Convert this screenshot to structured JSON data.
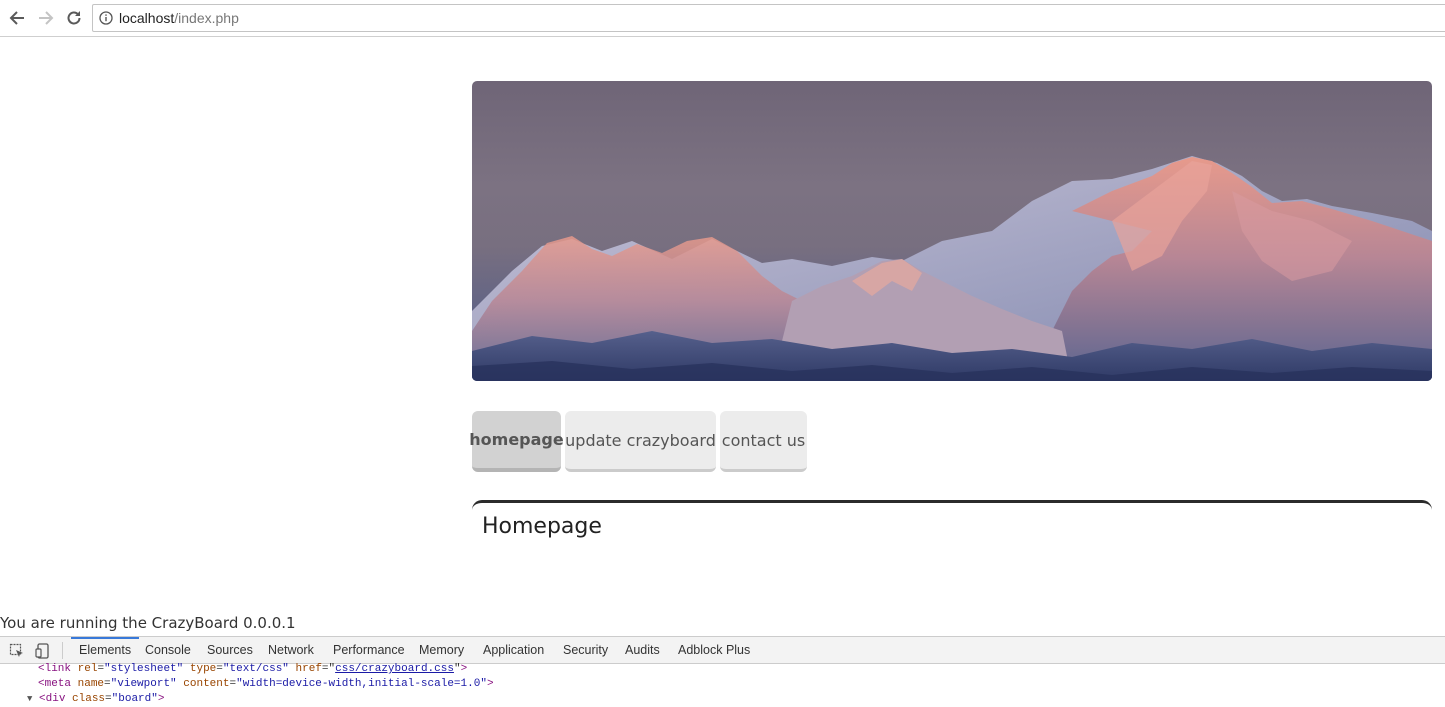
{
  "browser": {
    "url_host": "localhost",
    "url_path": "/index.php",
    "icons": [
      "back-arrow-icon",
      "forward-arrow-icon",
      "reload-icon",
      "info-icon"
    ]
  },
  "page": {
    "menu": [
      {
        "label": "homepage",
        "active": true
      },
      {
        "label": "update crazyboard",
        "active": false
      },
      {
        "label": "contact us",
        "active": false
      }
    ],
    "title": "Homepage",
    "footer_note": "You are running the CrazyBoard 0.0.0.1",
    "colors": {
      "tab_bg": "#ececec",
      "tab_active_bg": "#d2d2d2",
      "content_border": "#2b2b2b"
    }
  },
  "devtools": {
    "tabs": [
      "Elements",
      "Console",
      "Sources",
      "Network",
      "Performance",
      "Memory",
      "Application",
      "Security",
      "Audits",
      "Adblock Plus"
    ],
    "active_tab": "Elements",
    "icons": [
      "inspect-element-icon",
      "device-toolbar-icon"
    ],
    "source_lines": {
      "link": {
        "tag_open": "<link",
        "rel_attr": "rel",
        "rel_val": "\"stylesheet\"",
        "type_attr": "type",
        "type_val": "\"text/css\"",
        "href_attr": "href",
        "href_val": "css/crazyboard.css",
        "tag_close": ">"
      },
      "meta": {
        "tag_open": "<meta",
        "name_attr": "name",
        "name_val": "\"viewport\"",
        "content_attr": "content",
        "content_val": "\"width=device-width,initial-scale=1.0\"",
        "tag_close": ">"
      },
      "div": {
        "tag_open": "<div",
        "class_attr": "class",
        "class_val": "\"board\"",
        "tag_close": ">"
      }
    }
  }
}
